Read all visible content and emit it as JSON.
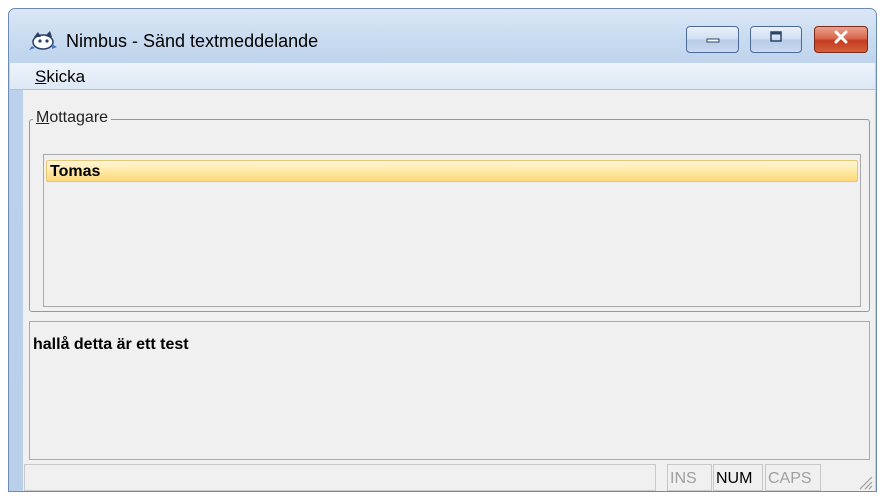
{
  "window": {
    "title": "Nimbus - Sänd textmeddelande",
    "icon": "nimbus-app-icon"
  },
  "titlebar_buttons": {
    "minimize_icon": "minimize-icon",
    "maximize_icon": "maximize-icon",
    "close_icon": "close-icon"
  },
  "menu": {
    "items": [
      {
        "label_accel": "S",
        "label_rest": "kicka"
      }
    ]
  },
  "recipients": {
    "legend_accel": "M",
    "legend_rest": "ottagare",
    "items": [
      {
        "name": "Tomas",
        "selected": true
      }
    ]
  },
  "message": {
    "text": "hallå detta är ett test"
  },
  "statusbar": {
    "indicators": [
      {
        "label": "INS",
        "active": false
      },
      {
        "label": "NUM",
        "active": true
      },
      {
        "label": "CAPS",
        "active": false
      }
    ]
  },
  "colors": {
    "selection_fill": "#fcd87a",
    "selection_border": "#e6c978",
    "close_button": "#c43c1f",
    "window_frame": "#b9cfea"
  }
}
